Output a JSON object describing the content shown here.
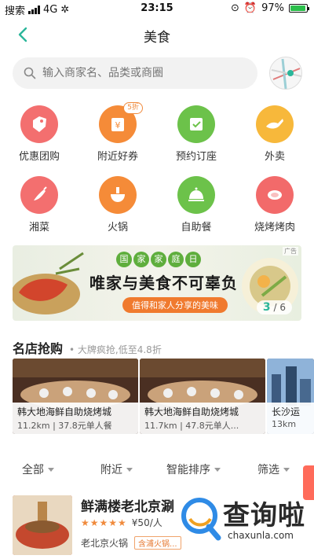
{
  "status_bar": {
    "carrier": "搜索",
    "network": "4G",
    "time": "23:15",
    "battery": "97%",
    "battery_level": 0.97
  },
  "nav": {
    "title": "美食"
  },
  "search": {
    "placeholder": "输入商家名、品类或商圈"
  },
  "categories": [
    {
      "label": "优惠团购",
      "icon": "discount-tag-icon",
      "color": "#f36f6f"
    },
    {
      "label": "附近好券",
      "icon": "coupon-icon",
      "color": "#f58b38",
      "badge": "5折"
    },
    {
      "label": "预约订座",
      "icon": "calendar-check-icon",
      "color": "#6cc24a"
    },
    {
      "label": "外卖",
      "icon": "delivery-icon",
      "color": "#f7b83b"
    },
    {
      "label": "湘菜",
      "icon": "chili-icon",
      "color": "#f36f6f"
    },
    {
      "label": "火锅",
      "icon": "hotpot-icon",
      "color": "#f58b38"
    },
    {
      "label": "自助餐",
      "icon": "buffet-icon",
      "color": "#6cc24a"
    },
    {
      "label": "烧烤烤肉",
      "icon": "meat-icon",
      "color": "#f26a6a"
    }
  ],
  "banner": {
    "ad_tag": "广告",
    "headline": "唯家与美食不可辜负",
    "tags": [
      "国",
      "家",
      "家",
      "庭",
      "日"
    ],
    "subline": "值得和家人分享的美味",
    "page_current": "3",
    "page_total": "/ 6"
  },
  "famous_stores": {
    "title": "名店抢购",
    "subtitle": "大牌疯抢,低至4.8折",
    "items": [
      {
        "name": "韩大地海鲜自助烧烤城",
        "meta": "11.2km | 37.8元单人餐"
      },
      {
        "name": "韩大地海鲜自助烧烤城",
        "meta": "11.7km | 47.8元单人..."
      },
      {
        "name": "长沙运",
        "meta": "13km"
      }
    ]
  },
  "filters": [
    {
      "label": "全部"
    },
    {
      "label": "附近"
    },
    {
      "label": "智能排序"
    },
    {
      "label": "筛选"
    }
  ],
  "list_item": {
    "title": "鲜满楼老北京涮",
    "stars": "★★★★★",
    "price": "¥50/人",
    "category": "老北京火锅",
    "tag": "含浦火锅..."
  },
  "watermark": {
    "text": "查询啦",
    "url": "chaxunla.com"
  },
  "colors": {
    "accent": "#2bb69a",
    "orange": "#f08a3c"
  }
}
